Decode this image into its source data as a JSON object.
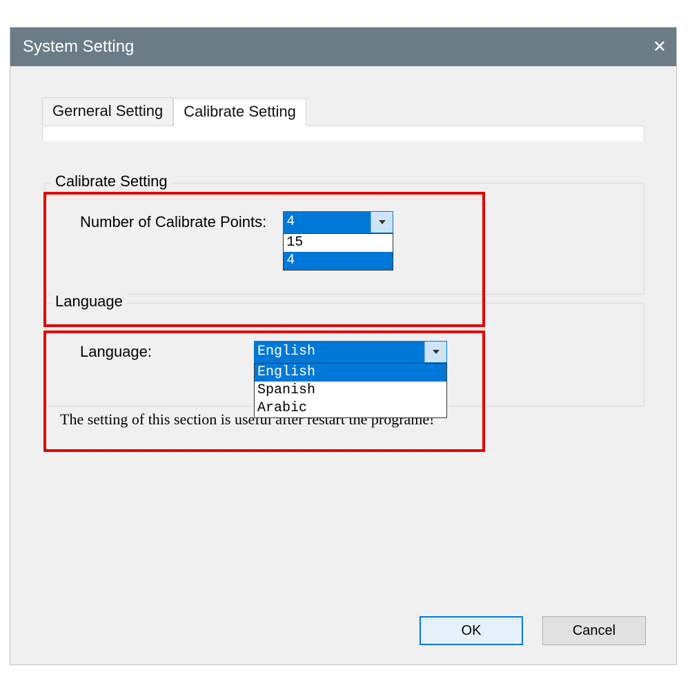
{
  "window": {
    "title": "System Setting"
  },
  "tabs": {
    "general": "Gerneral Setting",
    "calibrate": "Calibrate Setting"
  },
  "calibrate_group": {
    "legend": "Calibrate Setting",
    "label": "Number of Calibrate Points:",
    "selected": "4",
    "options": {
      "opt1": "15",
      "opt2": "4"
    }
  },
  "language_group": {
    "legend": "Language",
    "label": "Language:",
    "selected": "English",
    "options": {
      "opt1": "English",
      "opt2": "Spanish",
      "opt3": "Arabic"
    }
  },
  "hint": "The setting of this section is useful after restart the programe!",
  "buttons": {
    "ok": "OK",
    "cancel": "Cancel"
  }
}
